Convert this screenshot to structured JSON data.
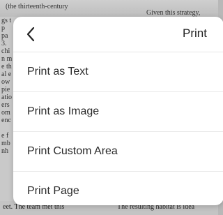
{
  "background": {
    "top_left": "(the thirteenth-century",
    "top_right": "Given this strategy,",
    "fragments": [
      "gs t",
      "p",
      "pa",
      "3.",
      "chi",
      "n m",
      "e th",
      "al e",
      "ow",
      "pie",
      "atio",
      "ers",
      "om",
      "enc",
      "",
      "e f",
      "mb",
      "nh"
    ],
    "bottom_left": "eet. The team met this",
    "bottom_right": "The resulting habitat is idea"
  },
  "dialog": {
    "back_icon": "chevron-left-icon",
    "title": "Print",
    "items": [
      {
        "label": "Print as Text"
      },
      {
        "label": "Print as Image"
      },
      {
        "label": "Print Custom Area"
      },
      {
        "label": "Print Page"
      }
    ]
  },
  "colors": {
    "sheet": "#ffffff",
    "divider": "#e9e9e9",
    "text": "#2a2a2a",
    "backdrop": "#c9c9c9"
  }
}
